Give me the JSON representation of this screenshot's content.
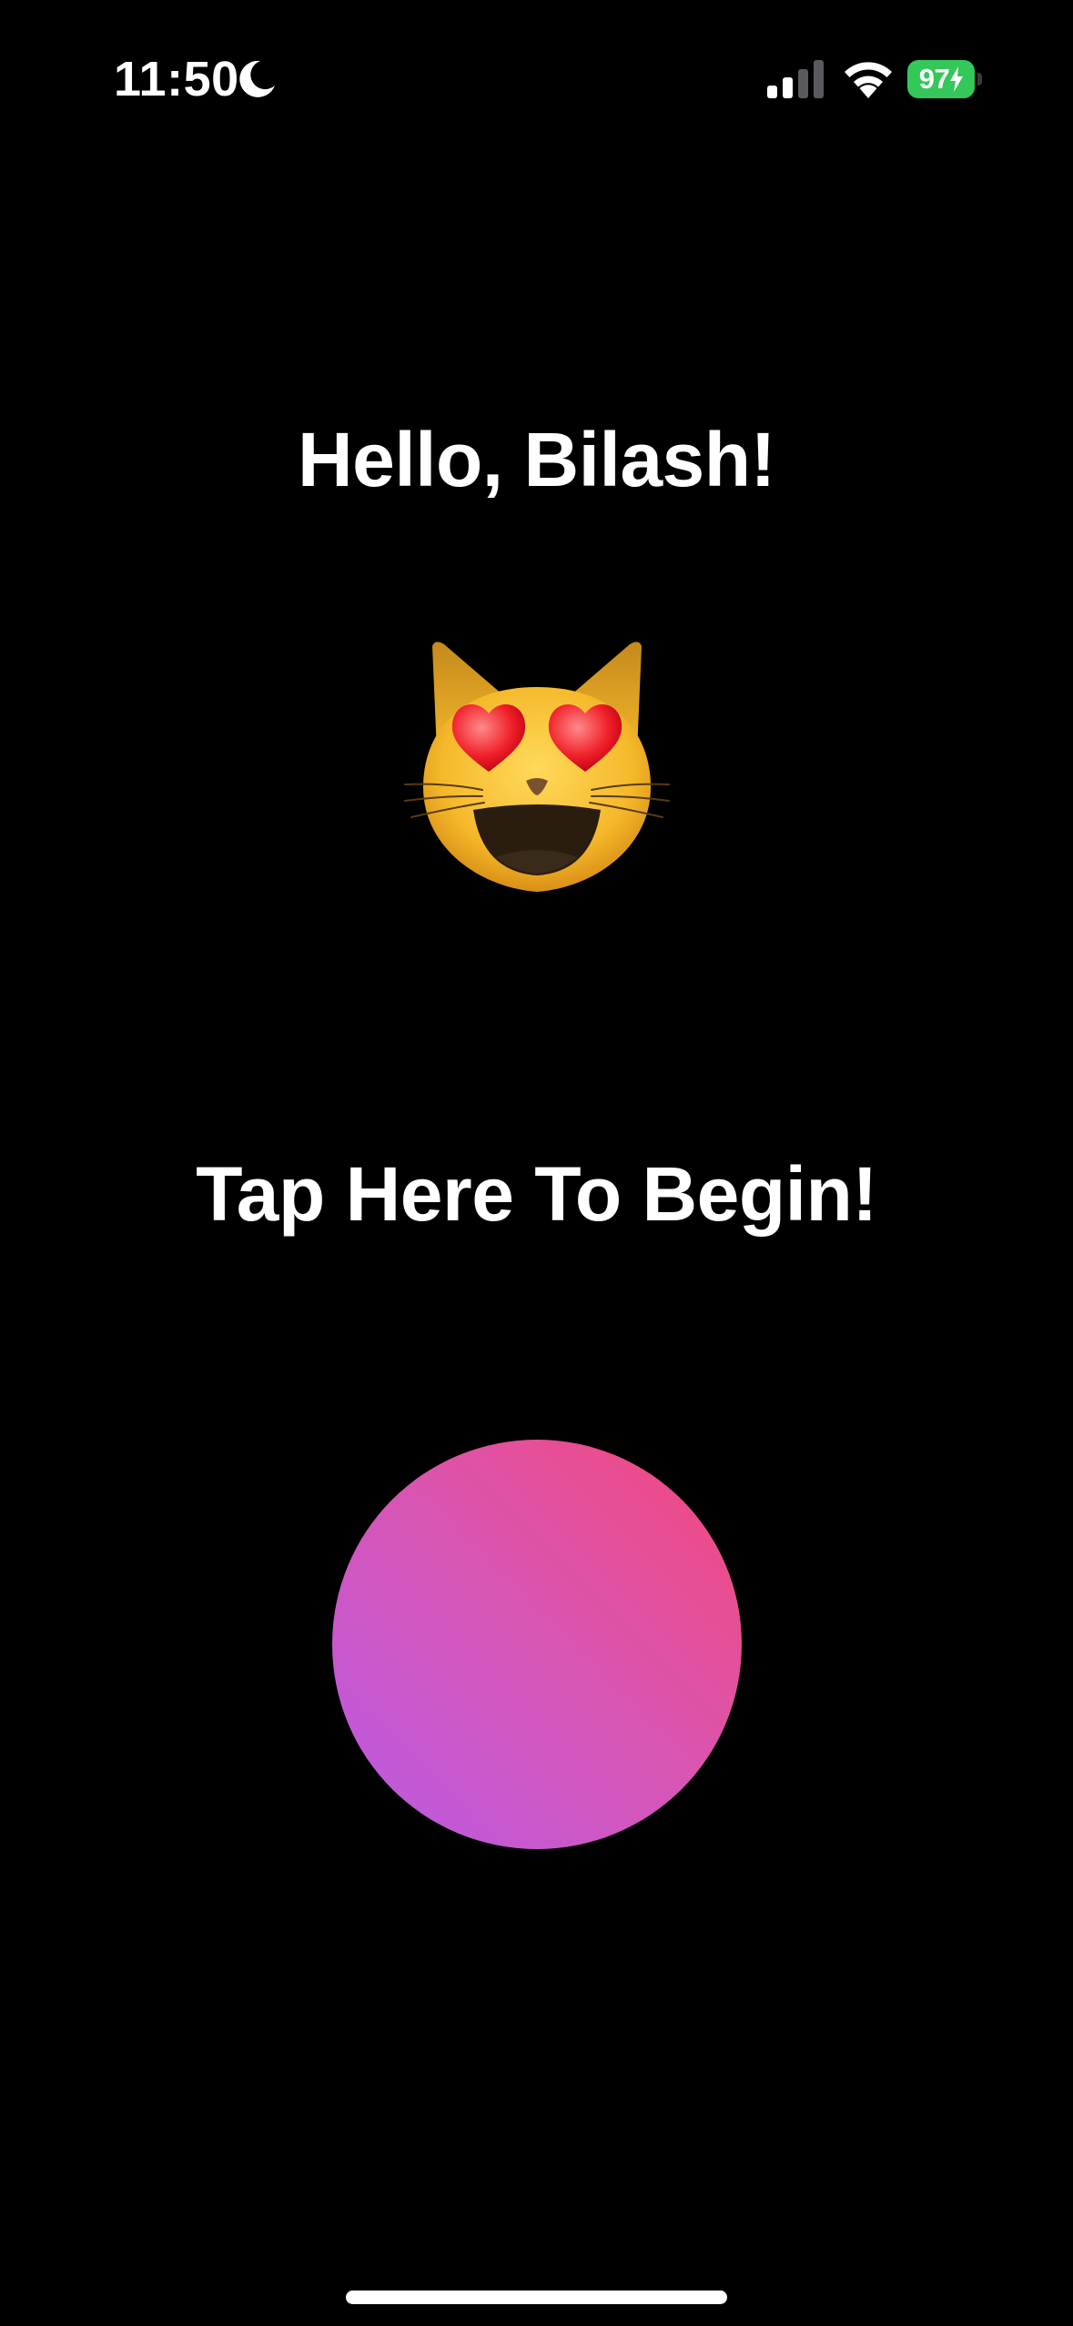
{
  "status_bar": {
    "time": "11:50",
    "battery_level": "97",
    "focus_icon": "moon-icon",
    "signal_icon": "cellular-signal-icon",
    "wifi_icon": "wifi-icon",
    "battery_icon": "battery-charging-icon",
    "battery_color": "#34c759"
  },
  "main": {
    "greeting": "Hello, Bilash!",
    "mascot_icon": "smiling-cat-heart-eyes-icon",
    "prompt": "Tap Here To Begin!",
    "button_gradient": [
      "#b95ae6",
      "#d756b5",
      "#f44879"
    ]
  },
  "colors": {
    "background": "#000000",
    "text": "#ffffff"
  }
}
